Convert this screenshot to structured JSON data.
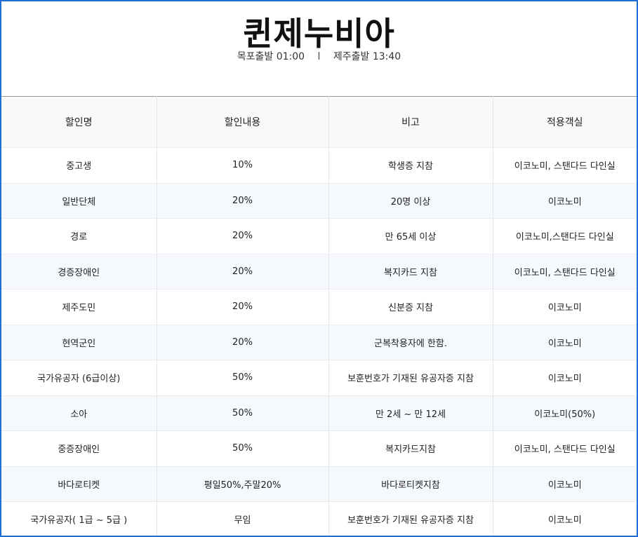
{
  "header": {
    "title": "퀸제누비아",
    "departure_mokpo": "목포출발 01:00",
    "separator": "l",
    "departure_jeju": "제주출발 13:40"
  },
  "table": {
    "columns": [
      "할인명",
      "할인내용",
      "비고",
      "적용객실"
    ],
    "rows": [
      {
        "name": "중고생",
        "discount": "10%",
        "note": "학생증 지참",
        "room": "이코노미, 스탠다드 다인실"
      },
      {
        "name": "일반단체",
        "discount": "20%",
        "note": "20명 이상",
        "room": "이코노미"
      },
      {
        "name": "경로",
        "discount": "20%",
        "note": "만 65세 이상",
        "room": "이코노미,스탠다드 다인실"
      },
      {
        "name": "경증장애인",
        "discount": "20%",
        "note": "복지카드 지참",
        "room": "이코노미, 스탠다드 다인실"
      },
      {
        "name": "제주도민",
        "discount": "20%",
        "note": "신분증 지참",
        "room": "이코노미"
      },
      {
        "name": "현역군인",
        "discount": "20%",
        "note": "군복착용자에 한함.",
        "room": "이코노미"
      },
      {
        "name": "국가유공자 (6급이상)",
        "discount": "50%",
        "note": "보훈번호가 기재된 유공자증 지참",
        "room": "이코노미"
      },
      {
        "name": "소아",
        "discount": "50%",
        "note": "만 2세 ~ 만 12세",
        "room": "이코노미(50%)"
      },
      {
        "name": "중증장애인",
        "discount": "50%",
        "note": "복지카드지참",
        "room": "이코노미, 스탠다드 다인실"
      },
      {
        "name": "바다로티켓",
        "discount": "평일50%,주말20%",
        "note": "바다로티켓지참",
        "room": "이코노미"
      },
      {
        "name": "국가유공자( 1급 ~ 5급 )",
        "discount": "무임",
        "note": "보훈번호가 기재된 유공자증 지참",
        "room": "이코노미"
      }
    ]
  },
  "colors": {
    "frame_border": "#1e6fd9",
    "row_alt_bg": "#f5f9fd",
    "header_bg": "#f9f9f9"
  }
}
